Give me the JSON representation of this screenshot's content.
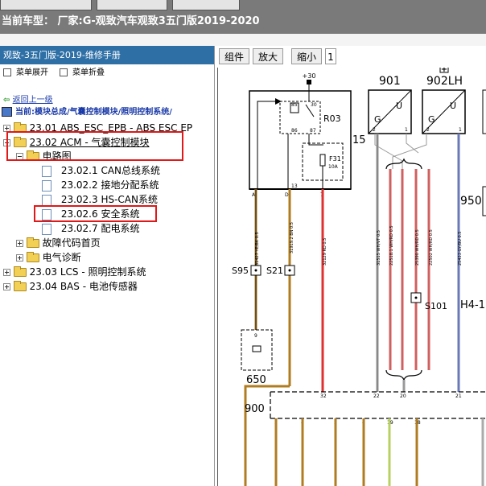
{
  "window": {
    "title": "当前车型： 厂家:G-观致汽车观致3五门版2019-2020"
  },
  "sidebar": {
    "header": "观致-3五门版-2019-维修手册",
    "expand_all": "菜单展开",
    "collapse_all": "菜单折叠",
    "back_link": "返回上一级",
    "current_path": "当前:模块总成/气囊控制模块/照明控制系统/",
    "tree": [
      {
        "label": "23.01 ABS_ESC_EPB - ABS ESC EP"
      },
      {
        "label": "23.02 ACM - 气囊控制模块"
      },
      {
        "label": "电路图"
      },
      {
        "label": "23.02.1 CAN总线系统"
      },
      {
        "label": "23.02.2 接地分配系统"
      },
      {
        "label": "23.02.3 HS-CAN系统"
      },
      {
        "label": "23.02.6 安全系统"
      },
      {
        "label": "23.02.7 配电系统"
      },
      {
        "label": "故障代码首页"
      },
      {
        "label": "电气诊断"
      },
      {
        "label": "23.03 LCS - 照明控制系统"
      },
      {
        "label": "23.04 BAS - 电池传感器"
      }
    ]
  },
  "toolbar": {
    "components": "组件",
    "zoom_in": "放大",
    "zoom_out": "缩小",
    "page": "1"
  },
  "diagram": {
    "labels": {
      "plus30": "+30",
      "relay": "R03",
      "fuse": "F31",
      "fuse_rating": "10A",
      "pin85": "85",
      "pin30": "30",
      "pin86": "86",
      "pin87": "87",
      "n15": "15",
      "n901": "901",
      "n902lh": "902LH",
      "n950": "950",
      "s95": "S95",
      "s21": "S21",
      "s101": "S101",
      "h4": "H4-1",
      "n650": "650",
      "n900": "900",
      "g": "G",
      "u": "U",
      "pinA": "A",
      "pinD": "D",
      "pin13": "13",
      "pin7": "7",
      "pin2": "2",
      "pin1": "1",
      "pin9": "9",
      "b32": "32",
      "b22": "22",
      "b20": "20",
      "b21": "21",
      "c3": "3",
      "c4": "4",
      "c2": "2",
      "c4b": "4",
      "c19": "19",
      "c18": "18",
      "w1": "31427 YE/BK 0.5",
      "w2": "31919.2 BN 0.5",
      "w3": "32129 RD 0.5",
      "w4": "31515 WH/VT 0.5",
      "w5": "22518.1 WH/RD 0.5",
      "w6": "25390 WH/RD 0.5",
      "w7": "22502 WH/RD 0.5",
      "w8": "25433 GY/BU 0.5"
    }
  }
}
